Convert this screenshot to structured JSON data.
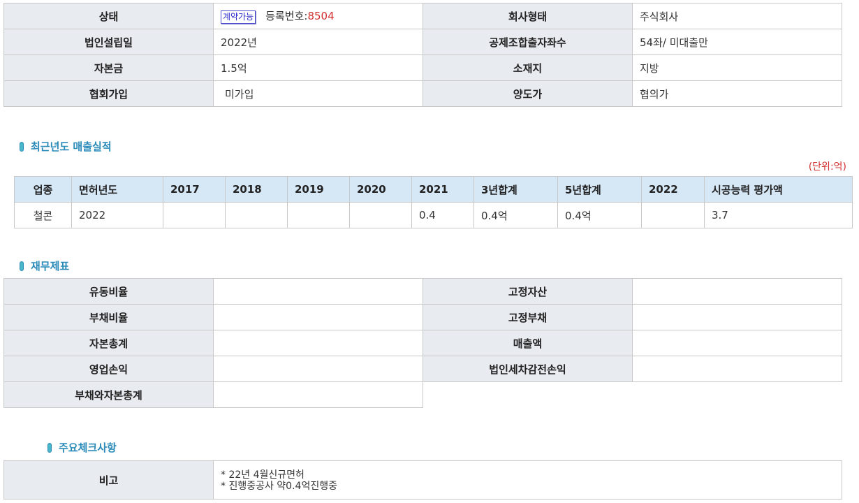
{
  "top_info": {
    "status_label": "상태",
    "status_badge": "계약가능",
    "reg_prefix": "등록번호:",
    "reg_no": "8504",
    "company_type_label": "회사형태",
    "company_type": "주식회사",
    "founded_label": "법인설립일",
    "founded": "2022년",
    "accounts_label": "공제조합출자좌수",
    "accounts": "54좌/ 미대출만",
    "capital_label": "자본금",
    "capital": "1.5억",
    "location_label": "소재지",
    "location": "지방",
    "assoc_label": "협회가입",
    "assoc": "미가입",
    "price_label": "양도가",
    "price": "협의가"
  },
  "sales": {
    "title": "최근년도 매출실적",
    "unit": "(단위:억)",
    "headers": [
      "업종",
      "면허년도",
      "2017",
      "2018",
      "2019",
      "2020",
      "2021",
      "3년합계",
      "5년합계",
      "2022",
      "시공능력 평가액"
    ],
    "rows": [
      [
        "철콘",
        "2022",
        "",
        "",
        "",
        "",
        "0.4",
        "0.4억",
        "0.4억",
        "",
        "3.7"
      ]
    ]
  },
  "finance": {
    "title": "재무제표",
    "rows": [
      {
        "l1": "유동비율",
        "v1": "",
        "l2": "고정자산",
        "v2": ""
      },
      {
        "l1": "부채비율",
        "v1": "",
        "l2": "고정부채",
        "v2": ""
      },
      {
        "l1": "자본총계",
        "v1": "",
        "l2": "매출액",
        "v2": ""
      },
      {
        "l1": "영업손익",
        "v1": "",
        "l2": "법인세차감전손익",
        "v2": ""
      },
      {
        "l1": "부채와자본총계",
        "v1": ""
      }
    ]
  },
  "notes": {
    "title": "주요체크사항",
    "label": "비고",
    "lines": [
      "* 22년 4월신규면허",
      "* 진행중공사 약0.4억진행중"
    ]
  },
  "colors": {
    "label_bg": "#e8ebf0",
    "header_bg": "#d6e7f6",
    "accent": "#2a8ab8",
    "red": "#d23030"
  }
}
